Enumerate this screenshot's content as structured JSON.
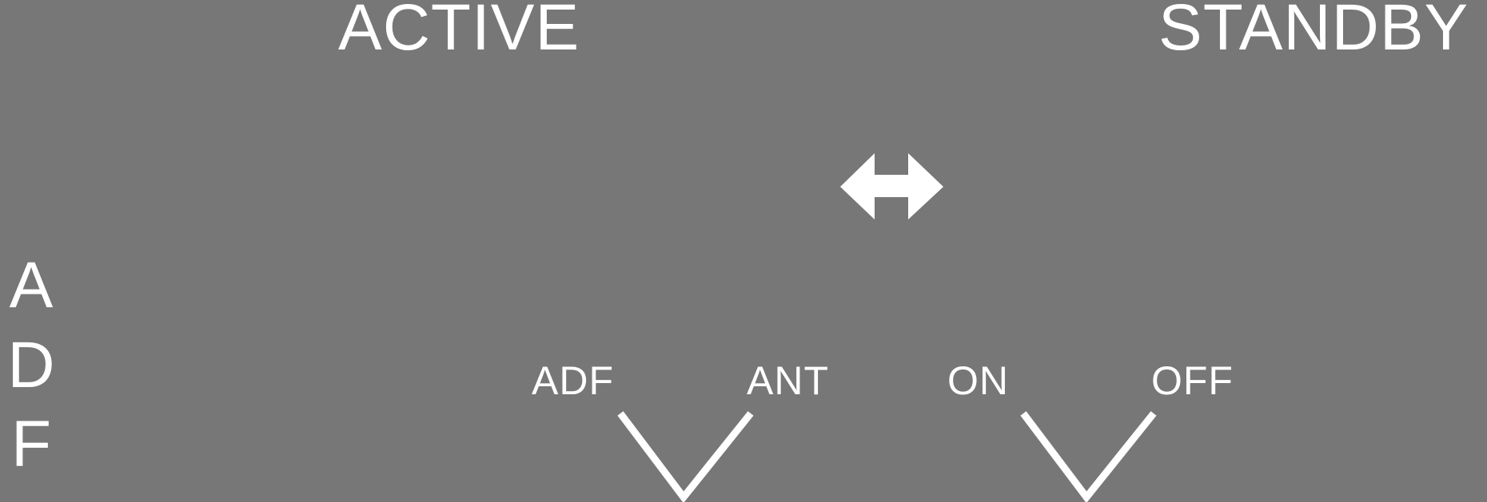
{
  "header": {
    "active_label": "ACTIVE",
    "standby_label": "STANDBY"
  },
  "side_title": {
    "letters": [
      "A",
      "D",
      "F"
    ]
  },
  "mode_switch": {
    "left_label": "ADF",
    "right_label": "ANT"
  },
  "power_switch": {
    "left_label": "ON",
    "right_label": "OFF"
  },
  "colors": {
    "background": "#777777",
    "foreground": "#ffffff"
  },
  "icons": {
    "transfer": "double-arrow-icon"
  }
}
